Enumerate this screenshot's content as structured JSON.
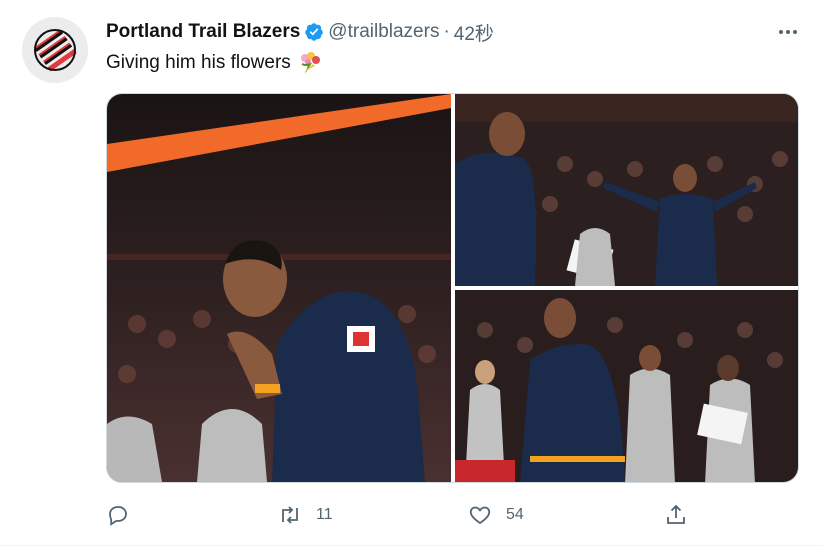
{
  "tweet": {
    "author_name": "Portland Trail Blazers",
    "handle": "@trailblazers",
    "separator": "·",
    "time": "42秒",
    "text": "Giving him his flowers",
    "text_emoji": "bouquet-emoji",
    "verified_icon": "verified-badge-icon",
    "more_icon": "more-icon"
  },
  "actions": {
    "reply": {
      "icon": "reply-icon",
      "count": ""
    },
    "retweet": {
      "icon": "retweet-icon",
      "count": "11"
    },
    "like": {
      "icon": "like-icon",
      "count": "54"
    },
    "share": {
      "icon": "share-icon",
      "count": ""
    }
  },
  "colors": {
    "brand_red": "#e03a3e",
    "verified_blue": "#1d9bf0",
    "jersey_navy": "#1a2b4c",
    "arena_orange": "#f26a2a",
    "muted_text": "#536471"
  }
}
